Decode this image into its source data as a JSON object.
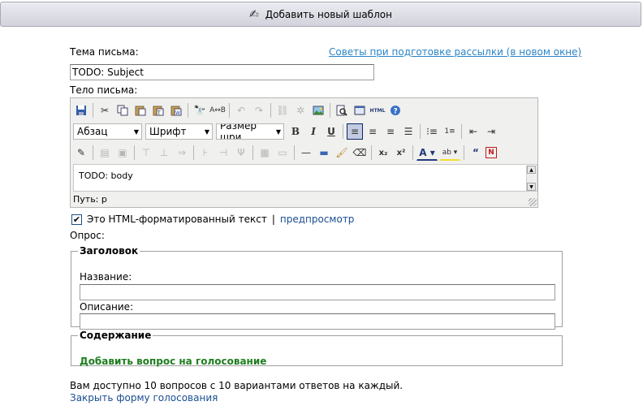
{
  "header": {
    "title": "Добавить новый шаблон",
    "icon": "pen-icon"
  },
  "subject": {
    "label": "Тема письма:",
    "value": "TODO: Subject",
    "tips_link": "Советы при подготовке рассылки (в новом окне)"
  },
  "body": {
    "label": "Тело письма:",
    "editor": {
      "format_select": "Абзац",
      "font_select": "Шрифт",
      "size_select": "Размер шри",
      "content": "TODO: body",
      "path": "Путь: p",
      "bold": "B",
      "italic": "I",
      "underline": "U",
      "html_label": "HTML"
    }
  },
  "html_option": {
    "checked": true,
    "label": "Это HTML-форматированный текст",
    "separator": "|",
    "preview_link": "предпросмотр"
  },
  "poll": {
    "label": "Опрос:",
    "header_section": {
      "legend": "Заголовок",
      "name_label": "Название:",
      "desc_label": "Описание:"
    },
    "content_section": {
      "legend": "Содержание",
      "add_question_link": "Добавить вопрос на голосование"
    },
    "limit_text": "Вам доступно 10 вопросов с 10 вариантами ответов на каждый.",
    "close_link": "Закрыть форму голосования"
  }
}
